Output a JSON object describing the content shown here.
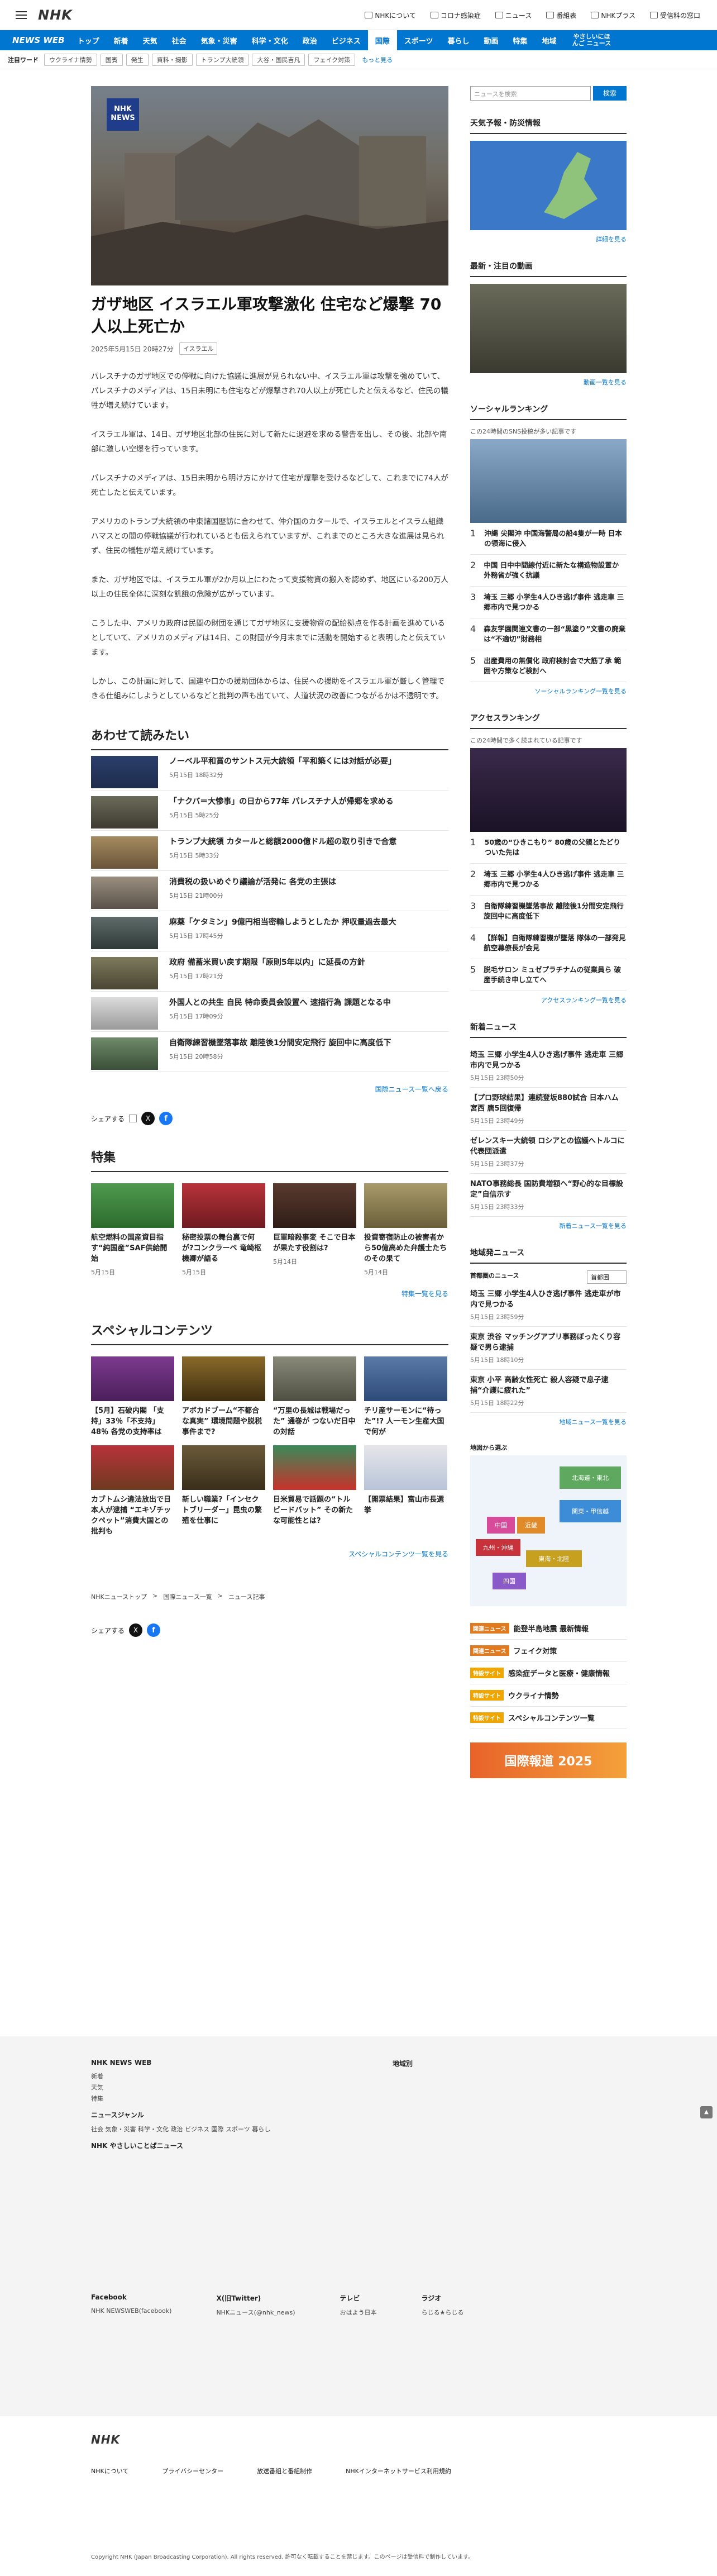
{
  "header": {
    "logo": "NHK",
    "links": [
      "NHKについて",
      "コロナ感染症",
      "ニュース",
      "番組表",
      "NHKプラス",
      "受信料の窓口"
    ]
  },
  "nav": {
    "brand": "NEWS WEB",
    "items": [
      "トップ",
      "新着",
      "天気",
      "社会",
      "気象・災害",
      "科学・文化",
      "政治",
      "ビジネス",
      "国際",
      "スポーツ",
      "暮らし",
      "動画",
      "特集",
      "地域"
    ],
    "active": "国際",
    "easy": "やさしいにほんご ニュース"
  },
  "keywords": {
    "label": "注目ワード",
    "items": [
      "ウクライナ情勢",
      "国賓",
      "発生",
      "資料・撮影",
      "トランプ大統領",
      "大谷・国民吉凡",
      "フェイク対策"
    ],
    "more": "もっと見る"
  },
  "article": {
    "title": "ガザ地区 イスラエル軍攻撃激化 住宅など爆撃 70人以上死亡か",
    "date": "2025年5月15日 20時27分",
    "tag": "イスラエル",
    "paragraphs": [
      "パレスチナのガザ地区での停戦に向けた協議に進展が見られない中、イスラエル軍は攻撃を強めていて、パレスチナのメディアは、15日未明にも住宅などが爆撃され70人以上が死亡したと伝えるなど、住民の犠牲が増え続けています。",
      "イスラエル軍は、14日、ガザ地区北部の住民に対して新たに退避を求める警告を出し、その後、北部や南部に激しい空爆を行っています。",
      "パレスチナのメディアは、15日未明から明け方にかけて住宅が爆撃を受けるなどして、これまでに74人が死亡したと伝えています。",
      "アメリカのトランプ大統領の中東諸国歴訪に合わせて、仲介国のカタールで、イスラエルとイスラム組織ハマスとの間の停戦協議が行われているとも伝えられていますが、これまでのところ大きな進展は見られず、住民の犠牲が増え続けています。",
      "また、ガザ地区では、イスラエル軍が2か月以上にわたって支援物資の搬入を認めず、地区にいる200万人以上の住民全体に深刻な飢餓の危険が広がっています。",
      "こうした中、アメリカ政府は民間の財団を通じてガザ地区に支援物資の配給拠点を作る計画を進めているとしていて、アメリカのメディアは14日、この財団が今月末までに活動を開始すると表明したと伝えています。",
      "しかし、この計画に対して、国連や口かの援助団体からは、住民への援助をイスラエル軍が厳しく管理できる仕組みにしようとしているなどと批判の声も出ていて、人道状況の改善につながるかは不透明です。"
    ]
  },
  "related": {
    "title": "あわせて読みたい",
    "items": [
      {
        "title": "ノーベル平和賞のサントス元大統領「平和築くには対話が必要」",
        "date": "5月15日 18時32分"
      },
      {
        "title": "「ナクバ＝大惨事」の日から77年 パレスチナ人が帰郷を求める",
        "date": "5月15日 5時25分"
      },
      {
        "title": "トランプ大統領 カタールと総額2000億ドル超の取り引きで合意",
        "date": "5月15日 5時33分"
      },
      {
        "title": "消費税の扱いめぐり議論が活発に 各党の主張は",
        "date": "5月15日 21時00分"
      },
      {
        "title": "麻薬「ケタミン」9億円相当密輸しようとしたか 押収量過去最大",
        "date": "5月15日 17時45分"
      },
      {
        "title": "政府 備蓄米買い戻す期限「原則5年以内」に延長の方針",
        "date": "5月15日 17時21分"
      },
      {
        "title": "外国人との共生 自民 特命委員会設置へ 速描行為 課題となる中",
        "date": "5月15日 17時09分"
      },
      {
        "title": "自衛隊練習機墜落事故 離陸後1分間安定飛行 旋回中に高度低下",
        "date": "5月15日 20時58分"
      }
    ],
    "more": "国際ニュース一覧へ戻る"
  },
  "share": {
    "label": "シェアする"
  },
  "tokushu": {
    "title": "特集",
    "items": [
      {
        "title": "航空燃料の国産資目指す“純国産”SAF供給開始",
        "date": "5月15日"
      },
      {
        "title": "秘密投票の舞台裏で何が?コンクラーベ 竜崎枢機卿が語る",
        "date": "5月15日"
      },
      {
        "title": "巨軍暗殺事変 そこで日本が果たす役割は?",
        "date": "5月14日"
      },
      {
        "title": "投資寄宿防止の被害者から50億高めた弁護士たちのその果て",
        "date": "5月14日"
      }
    ],
    "more": "特集一覧を見る"
  },
  "special": {
    "title": "スペシャルコンテンツ",
    "items": [
      {
        "title": "【5月】石破内閣 「支持」33％「不支持」48％ 各党の支持率は"
      },
      {
        "title": "アボカドブーム“不都合な真実” 環境問題や脱税事件まで?"
      },
      {
        "title": "“万里の長城は戦場だった” 通巻が つないだ日中の対話"
      },
      {
        "title": "チリ産サーモンに“待った”!? 人一モン生産大国で何が"
      },
      {
        "title": "カブトムシ違法放出で日本人が逮捕 “エキゾチックペット”消費大国との批判も"
      },
      {
        "title": "新しい職業?「インセクトブリーダー」昆虫の繁殖を仕事に"
      },
      {
        "title": "日米貿易で話題の“トルビードバット” その新たな可能性とは?"
      },
      {
        "title": "【開票結果】富山市長選挙"
      }
    ],
    "more": "スペシャルコンテンツ一覧を見る"
  },
  "breadcrumb": [
    "NHKニューストップ",
    "国際ニュース一覧",
    "ニュース記事"
  ],
  "side": {
    "search_placeholder": "ニュースを検索",
    "search_btn": "検索",
    "weather_title": "天気予報・防災情報",
    "weather_more": "詳細を見る",
    "latest_title": "最新・注目の動画",
    "latest_more": "動画一覧を見る",
    "social_title": "ソーシャルランキング",
    "social_sub": "この24時間のSNS投稿が多い記事です",
    "social": [
      "沖縄 尖閣沖 中国海警局の船4隻が一時 日本の領海に侵入",
      "中国 日中中間線付近に新たな構造物設置か 外務省が強く抗議",
      "埼玉 三郷 小学生4人ひき逃げ事件 逃走車 三郷市内で見つかる",
      "森友学園関連文書の一部“黒塗り”文書の廃棄は“不適切”財務相",
      "出産費用の無償化 政府検討会で大筋了承 範囲や方策など検討へ"
    ],
    "social_more": "ソーシャルランキング一覧を見る",
    "access_title": "アクセスランキング",
    "access_sub": "この24時間で多く読まれている記事です",
    "access": [
      "50歳の“ひきこもり” 80歳の父親とたどりついた先は",
      "埼玉 三郷 小学生4人ひき逃げ事件 逃走車 三郷市内で見つかる",
      "自衛隊練習機墜落事故 離陸後1分間安定飛行 旋回中に高度低下",
      "【詳報】自衛隊練習機が墜落 隊体の一部発見 航空幕僚長が会見",
      "脱毛サロン ミュゼプラチナムの従業員ら 破産手続き申し立てへ"
    ],
    "access_more": "アクセスランキング一覧を見る",
    "new_title": "新着ニュース",
    "new": [
      {
        "t": "埼玉 三郷 小学生4人ひき逃げ事件 逃走車 三郷市内で見つかる",
        "d": "5月15日 23時50分"
      },
      {
        "t": "【プロ野球結果】連続登坂880試合 日本ハム 宮西 唐5回復帰",
        "d": "5月15日 23時49分"
      },
      {
        "t": "ゼレンスキー大統領 ロシアとの協議へトルコに代表団派遣",
        "d": "5月15日 23時37分"
      },
      {
        "t": "NATO事務総長 国防費増額へ“野心的な目標設定”自信示す",
        "d": "5月15日 23時33分"
      }
    ],
    "new_more": "新着ニュース一覧を見る",
    "local_title": "地域発ニュース",
    "local_sub": "首都圏のニュース",
    "local_select": "首都圏",
    "local": [
      {
        "t": "埼玉 三郷 小学生4人ひき逃げ事件 逃走車が市内で見つかる",
        "d": "5月15日 23時59分"
      },
      {
        "t": "東京 渋谷 マッチングアプリ事務ぼったくり容疑で男ら逮捕",
        "d": "5月15日 18時10分"
      },
      {
        "t": "東京 小平 高齢女性死亡 殺人容疑で息子逮捕“介護に疲れた”",
        "d": "5月15日 18時22分"
      }
    ],
    "local_more": "地域ニュース一覧を見る",
    "map_title": "地図から選ぶ",
    "regions": [
      "北海道・東北",
      "関東・甲信越",
      "中国",
      "近畿",
      "東海・北陸",
      "九州・沖縄",
      "四国"
    ],
    "promos": [
      {
        "chip": "関連ニュース",
        "t": "能登半島地震 最新情報"
      },
      {
        "chip": "関連ニュース",
        "t": "フェイク対策"
      },
      {
        "chip": "特設サイト",
        "t": "感染症データと医療・健康情報"
      },
      {
        "chip": "特設サイト",
        "t": "ウクライナ情勢"
      },
      {
        "chip": "特設サイト",
        "t": "スペシャルコンテンツ一覧"
      }
    ],
    "banner": "国際報道 2025"
  },
  "footer": {
    "brand": "NHK NEWS WEB",
    "cols1": [
      "新着",
      "天気",
      "特集"
    ],
    "cols2_title": "ニュースジャンル",
    "genres": "社会 気象・災害 科学・文化 政治 ビジネス 国際 スポーツ 暮らし",
    "easy": "NHK やさしいことばニュース",
    "region_title": "地域別",
    "sns": [
      {
        "h": "Facebook",
        "l": "NHK NEWSWEB(facebook)"
      },
      {
        "h": "X(旧Twitter)",
        "l": "NHKニュース(@nhk_news)"
      },
      {
        "h": "テレビ",
        "l": "おはよう日本"
      },
      {
        "h": "ラジオ",
        "l": "らじる★らじる"
      }
    ],
    "bottom_links": [
      "NHKについて",
      "プライバシーセンター",
      "放送番組と番組制作",
      "NHKインターネットサービス利用規約"
    ],
    "copyright": "Copyright NHK (Japan Broadcasting Corporation). All rights reserved. 許可なく転載することを禁じます。このページは受信料で制作しています。"
  }
}
